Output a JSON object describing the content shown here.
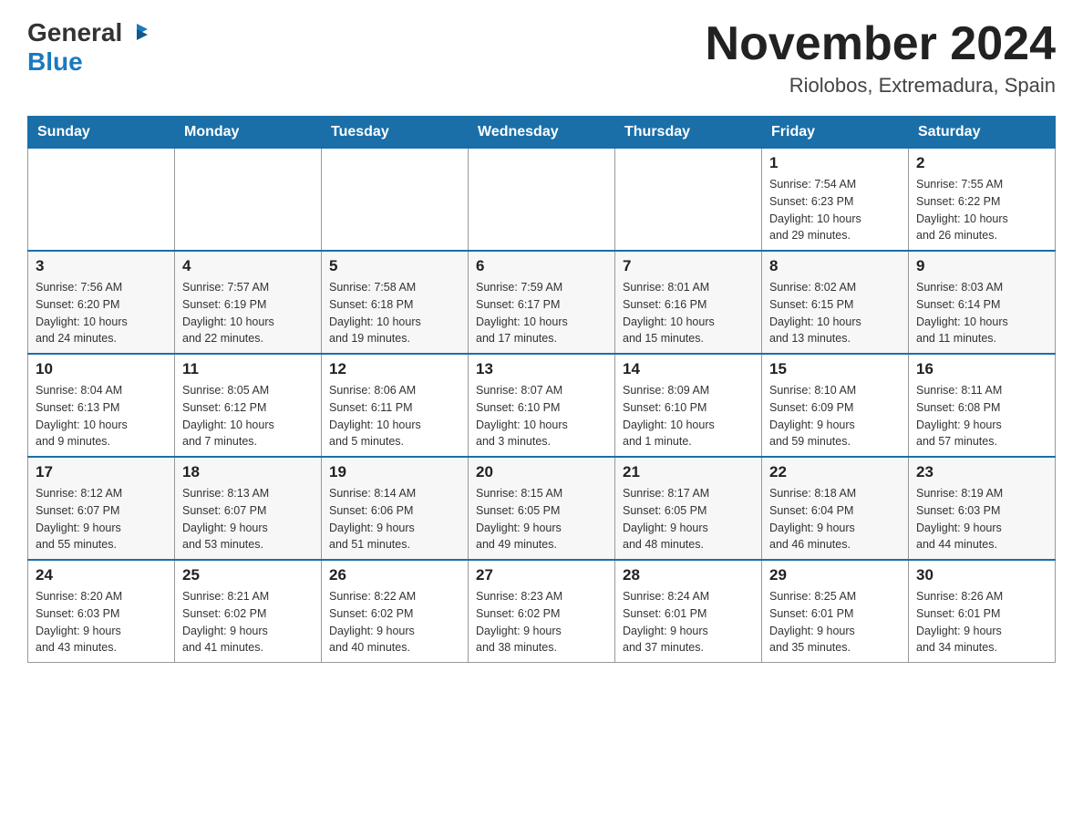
{
  "logo": {
    "text_general": "General",
    "text_blue": "Blue"
  },
  "title": "November 2024",
  "subtitle": "Riolobos, Extremadura, Spain",
  "weekdays": [
    "Sunday",
    "Monday",
    "Tuesday",
    "Wednesday",
    "Thursday",
    "Friday",
    "Saturday"
  ],
  "weeks": [
    [
      {
        "day": "",
        "info": ""
      },
      {
        "day": "",
        "info": ""
      },
      {
        "day": "",
        "info": ""
      },
      {
        "day": "",
        "info": ""
      },
      {
        "day": "",
        "info": ""
      },
      {
        "day": "1",
        "info": "Sunrise: 7:54 AM\nSunset: 6:23 PM\nDaylight: 10 hours\nand 29 minutes."
      },
      {
        "day": "2",
        "info": "Sunrise: 7:55 AM\nSunset: 6:22 PM\nDaylight: 10 hours\nand 26 minutes."
      }
    ],
    [
      {
        "day": "3",
        "info": "Sunrise: 7:56 AM\nSunset: 6:20 PM\nDaylight: 10 hours\nand 24 minutes."
      },
      {
        "day": "4",
        "info": "Sunrise: 7:57 AM\nSunset: 6:19 PM\nDaylight: 10 hours\nand 22 minutes."
      },
      {
        "day": "5",
        "info": "Sunrise: 7:58 AM\nSunset: 6:18 PM\nDaylight: 10 hours\nand 19 minutes."
      },
      {
        "day": "6",
        "info": "Sunrise: 7:59 AM\nSunset: 6:17 PM\nDaylight: 10 hours\nand 17 minutes."
      },
      {
        "day": "7",
        "info": "Sunrise: 8:01 AM\nSunset: 6:16 PM\nDaylight: 10 hours\nand 15 minutes."
      },
      {
        "day": "8",
        "info": "Sunrise: 8:02 AM\nSunset: 6:15 PM\nDaylight: 10 hours\nand 13 minutes."
      },
      {
        "day": "9",
        "info": "Sunrise: 8:03 AM\nSunset: 6:14 PM\nDaylight: 10 hours\nand 11 minutes."
      }
    ],
    [
      {
        "day": "10",
        "info": "Sunrise: 8:04 AM\nSunset: 6:13 PM\nDaylight: 10 hours\nand 9 minutes."
      },
      {
        "day": "11",
        "info": "Sunrise: 8:05 AM\nSunset: 6:12 PM\nDaylight: 10 hours\nand 7 minutes."
      },
      {
        "day": "12",
        "info": "Sunrise: 8:06 AM\nSunset: 6:11 PM\nDaylight: 10 hours\nand 5 minutes."
      },
      {
        "day": "13",
        "info": "Sunrise: 8:07 AM\nSunset: 6:10 PM\nDaylight: 10 hours\nand 3 minutes."
      },
      {
        "day": "14",
        "info": "Sunrise: 8:09 AM\nSunset: 6:10 PM\nDaylight: 10 hours\nand 1 minute."
      },
      {
        "day": "15",
        "info": "Sunrise: 8:10 AM\nSunset: 6:09 PM\nDaylight: 9 hours\nand 59 minutes."
      },
      {
        "day": "16",
        "info": "Sunrise: 8:11 AM\nSunset: 6:08 PM\nDaylight: 9 hours\nand 57 minutes."
      }
    ],
    [
      {
        "day": "17",
        "info": "Sunrise: 8:12 AM\nSunset: 6:07 PM\nDaylight: 9 hours\nand 55 minutes."
      },
      {
        "day": "18",
        "info": "Sunrise: 8:13 AM\nSunset: 6:07 PM\nDaylight: 9 hours\nand 53 minutes."
      },
      {
        "day": "19",
        "info": "Sunrise: 8:14 AM\nSunset: 6:06 PM\nDaylight: 9 hours\nand 51 minutes."
      },
      {
        "day": "20",
        "info": "Sunrise: 8:15 AM\nSunset: 6:05 PM\nDaylight: 9 hours\nand 49 minutes."
      },
      {
        "day": "21",
        "info": "Sunrise: 8:17 AM\nSunset: 6:05 PM\nDaylight: 9 hours\nand 48 minutes."
      },
      {
        "day": "22",
        "info": "Sunrise: 8:18 AM\nSunset: 6:04 PM\nDaylight: 9 hours\nand 46 minutes."
      },
      {
        "day": "23",
        "info": "Sunrise: 8:19 AM\nSunset: 6:03 PM\nDaylight: 9 hours\nand 44 minutes."
      }
    ],
    [
      {
        "day": "24",
        "info": "Sunrise: 8:20 AM\nSunset: 6:03 PM\nDaylight: 9 hours\nand 43 minutes."
      },
      {
        "day": "25",
        "info": "Sunrise: 8:21 AM\nSunset: 6:02 PM\nDaylight: 9 hours\nand 41 minutes."
      },
      {
        "day": "26",
        "info": "Sunrise: 8:22 AM\nSunset: 6:02 PM\nDaylight: 9 hours\nand 40 minutes."
      },
      {
        "day": "27",
        "info": "Sunrise: 8:23 AM\nSunset: 6:02 PM\nDaylight: 9 hours\nand 38 minutes."
      },
      {
        "day": "28",
        "info": "Sunrise: 8:24 AM\nSunset: 6:01 PM\nDaylight: 9 hours\nand 37 minutes."
      },
      {
        "day": "29",
        "info": "Sunrise: 8:25 AM\nSunset: 6:01 PM\nDaylight: 9 hours\nand 35 minutes."
      },
      {
        "day": "30",
        "info": "Sunrise: 8:26 AM\nSunset: 6:01 PM\nDaylight: 9 hours\nand 34 minutes."
      }
    ]
  ]
}
